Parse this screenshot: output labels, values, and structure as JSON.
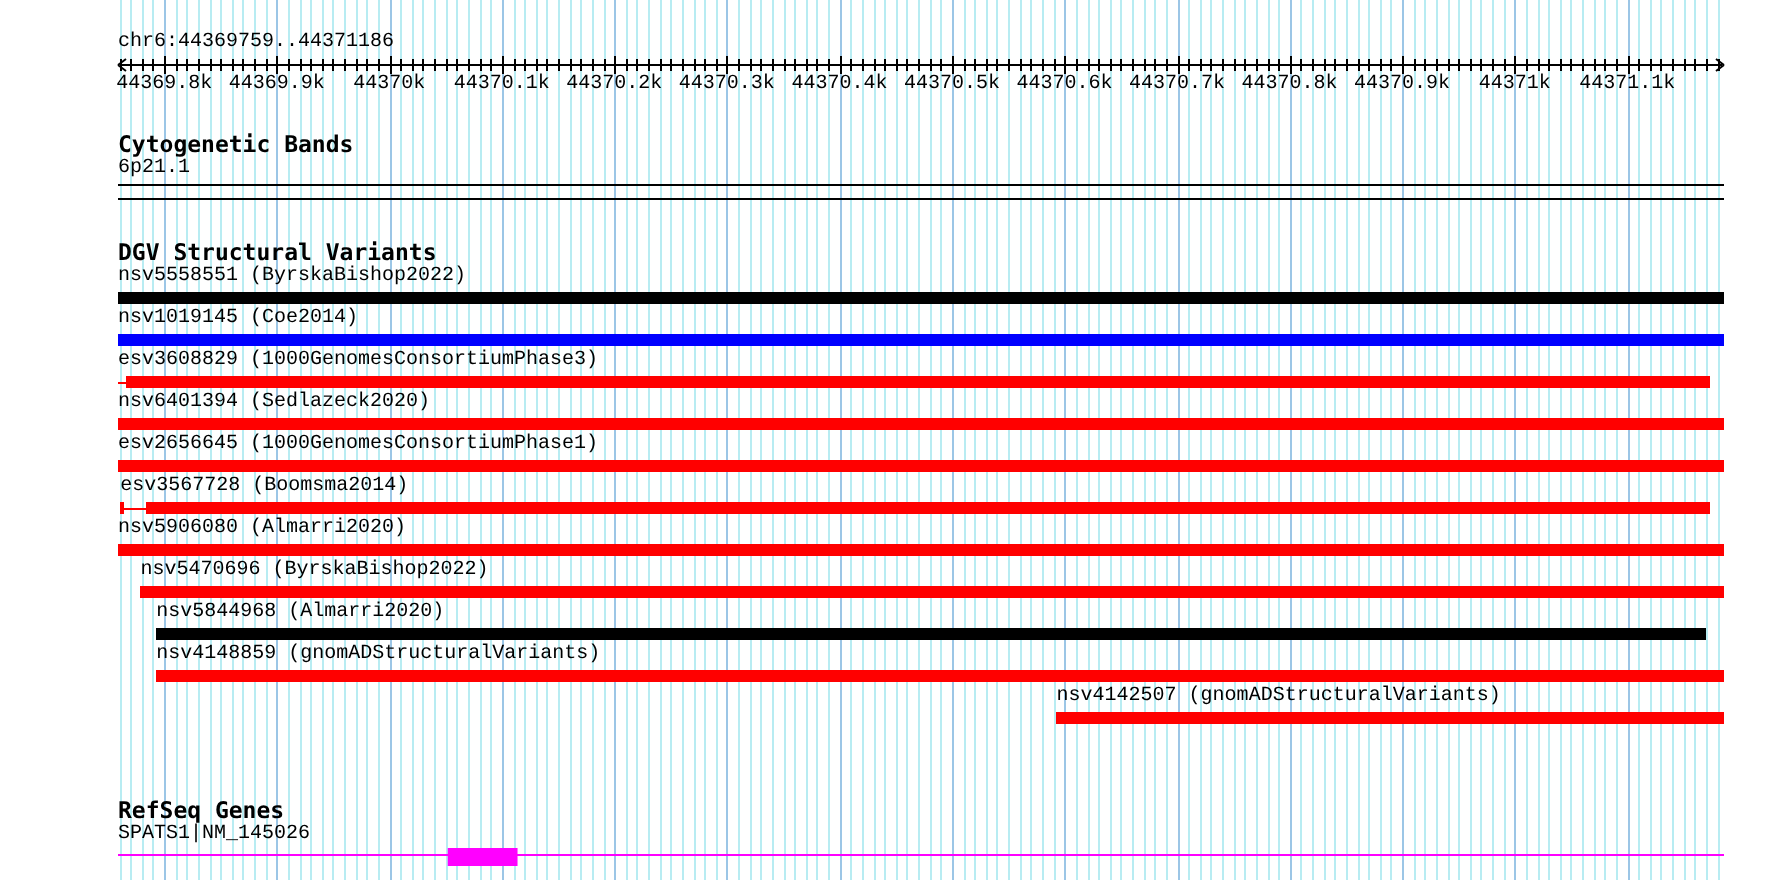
{
  "ruler": {
    "location": "chr6:44369759..44371186",
    "ticks": [
      "44369.8k",
      "44369.9k",
      "44370k",
      "44370.1k",
      "44370.2k",
      "44370.3k",
      "44370.4k",
      "44370.5k",
      "44370.6k",
      "44370.7k",
      "44370.8k",
      "44370.9k",
      "44371k",
      "44371.1k"
    ]
  },
  "tracks": [
    {
      "kind": "cytoband",
      "title": "Cytogenetic Bands",
      "band": "6p21.1"
    },
    {
      "kind": "variants",
      "title": "DGV Structural Variants",
      "features": [
        {
          "label": "nsv5558551 (ByrskaBishop2022)",
          "color": "#000000"
        },
        {
          "label": "nsv1019145 (Coe2014)",
          "color": "#0000ff"
        },
        {
          "label": "esv3608829 (1000GenomesConsortiumPhase3)",
          "color": "#ff0000"
        },
        {
          "label": "nsv6401394 (Sedlazeck2020)",
          "color": "#ff0000"
        },
        {
          "label": "esv2656645 (1000GenomesConsortiumPhase1)",
          "color": "#ff0000"
        },
        {
          "label": "esv3567728 (Boomsma2014)",
          "color": "#ff0000"
        },
        {
          "label": "nsv5906080 (Almarri2020)",
          "color": "#ff0000"
        },
        {
          "label": "nsv5470696 (ByrskaBishop2022)",
          "color": "#ff0000"
        },
        {
          "label": "nsv5844968 (Almarri2020)",
          "color": "#000000"
        },
        {
          "label": "nsv4148859 (gnomADStructuralVariants)",
          "color": "#ff0000"
        },
        {
          "label": "nsv4142507 (gnomADStructuralVariants)",
          "color": "#ff0000"
        }
      ]
    },
    {
      "kind": "genes",
      "title": "RefSeq Genes",
      "gene": {
        "label": "SPATS1|NM_145026"
      }
    }
  ]
}
